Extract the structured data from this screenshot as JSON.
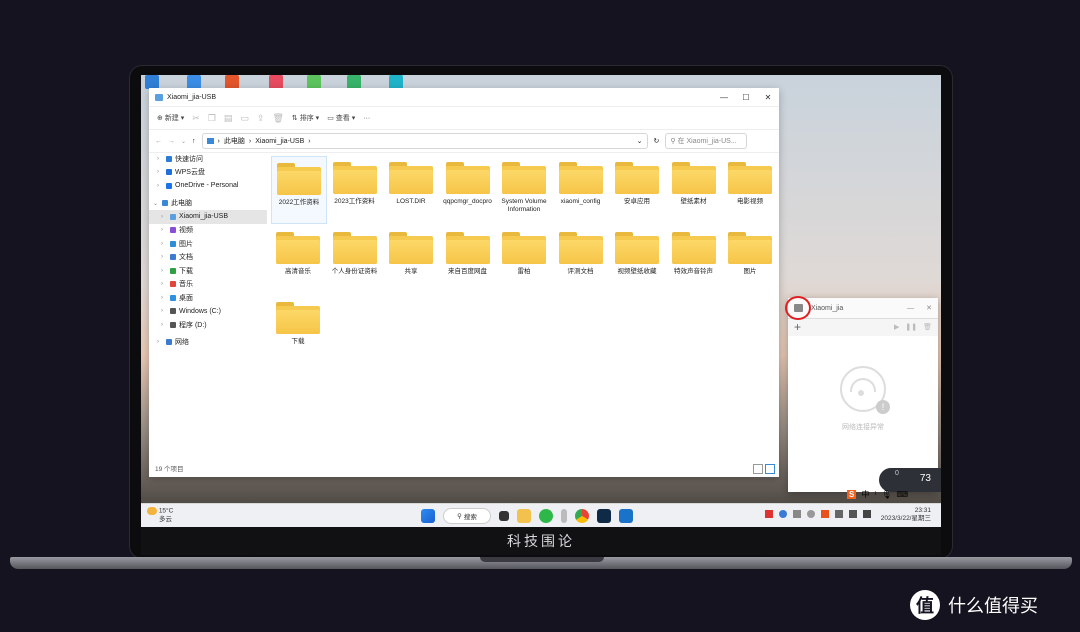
{
  "explorer": {
    "title": "Xiaomi_jia-USB",
    "toolbar": {
      "new_label": "新建",
      "sort_label": "排序",
      "view_label": "查看",
      "more": "···"
    },
    "breadcrumb": [
      "此电脑",
      "Xiaomi_jia-USB"
    ],
    "search_placeholder": "在 Xiaomi_jia-US...",
    "nav": [
      {
        "label": "快速访问",
        "icon": "star-icon",
        "color": "#2b7bd9"
      },
      {
        "label": "WPS云盘",
        "icon": "cloud-icon",
        "color": "#1e6fd9"
      },
      {
        "label": "OneDrive - Personal",
        "icon": "onedrive-icon",
        "color": "#1a73e8"
      },
      {
        "label": "此电脑",
        "icon": "pc-icon",
        "color": "#3a88d8"
      },
      {
        "label": "Xiaomi_jia-USB",
        "icon": "usb-drive-icon",
        "color": "#5aa0e0"
      },
      {
        "label": "视频",
        "icon": "video-icon",
        "color": "#8a4ed6"
      },
      {
        "label": "图片",
        "icon": "image-icon",
        "color": "#2e8fd8"
      },
      {
        "label": "文档",
        "icon": "document-icon",
        "color": "#3d7bd0"
      },
      {
        "label": "下载",
        "icon": "download-icon",
        "color": "#2ea043"
      },
      {
        "label": "音乐",
        "icon": "music-icon",
        "color": "#e0473a"
      },
      {
        "label": "桌面",
        "icon": "desktop-icon",
        "color": "#2f8fe0"
      },
      {
        "label": "Windows (C:)",
        "icon": "disk-icon",
        "color": "#555555"
      },
      {
        "label": "程序 (D:)",
        "icon": "disk-icon",
        "color": "#555555"
      },
      {
        "label": "网络",
        "icon": "network-icon",
        "color": "#3d7bd0"
      }
    ],
    "folders": [
      "2022工作资料",
      "2023工作资料",
      "LOST.DIR",
      "qqpcmgr_docpro",
      "System Volume Information",
      "xiaomi_config",
      "安卓应用",
      "壁纸素材",
      "电影视频",
      "高清音乐",
      "个人身份证资料",
      "共享",
      "来自百度网盘",
      "雷柏",
      "评测文档",
      "视频壁纸收藏",
      "特效声音铃声",
      "图片",
      "下载"
    ],
    "status": "19 个项目"
  },
  "xiaomi_window": {
    "title": "Xiaomi_jia",
    "message": "网络连接异常"
  },
  "taskbar": {
    "temperature": "15°C",
    "weather": "多云",
    "search_label": "搜索",
    "time": "23:31",
    "date": "2023/3/22/星期三",
    "gauge_value": "73",
    "gauge_small": "0"
  },
  "laptop": {
    "brand_text": "科技围论"
  },
  "watermark": {
    "logo": "值",
    "text": "什么值得买"
  },
  "colors": {
    "folder": "#f6c94f",
    "accent": "#1a73e8"
  }
}
